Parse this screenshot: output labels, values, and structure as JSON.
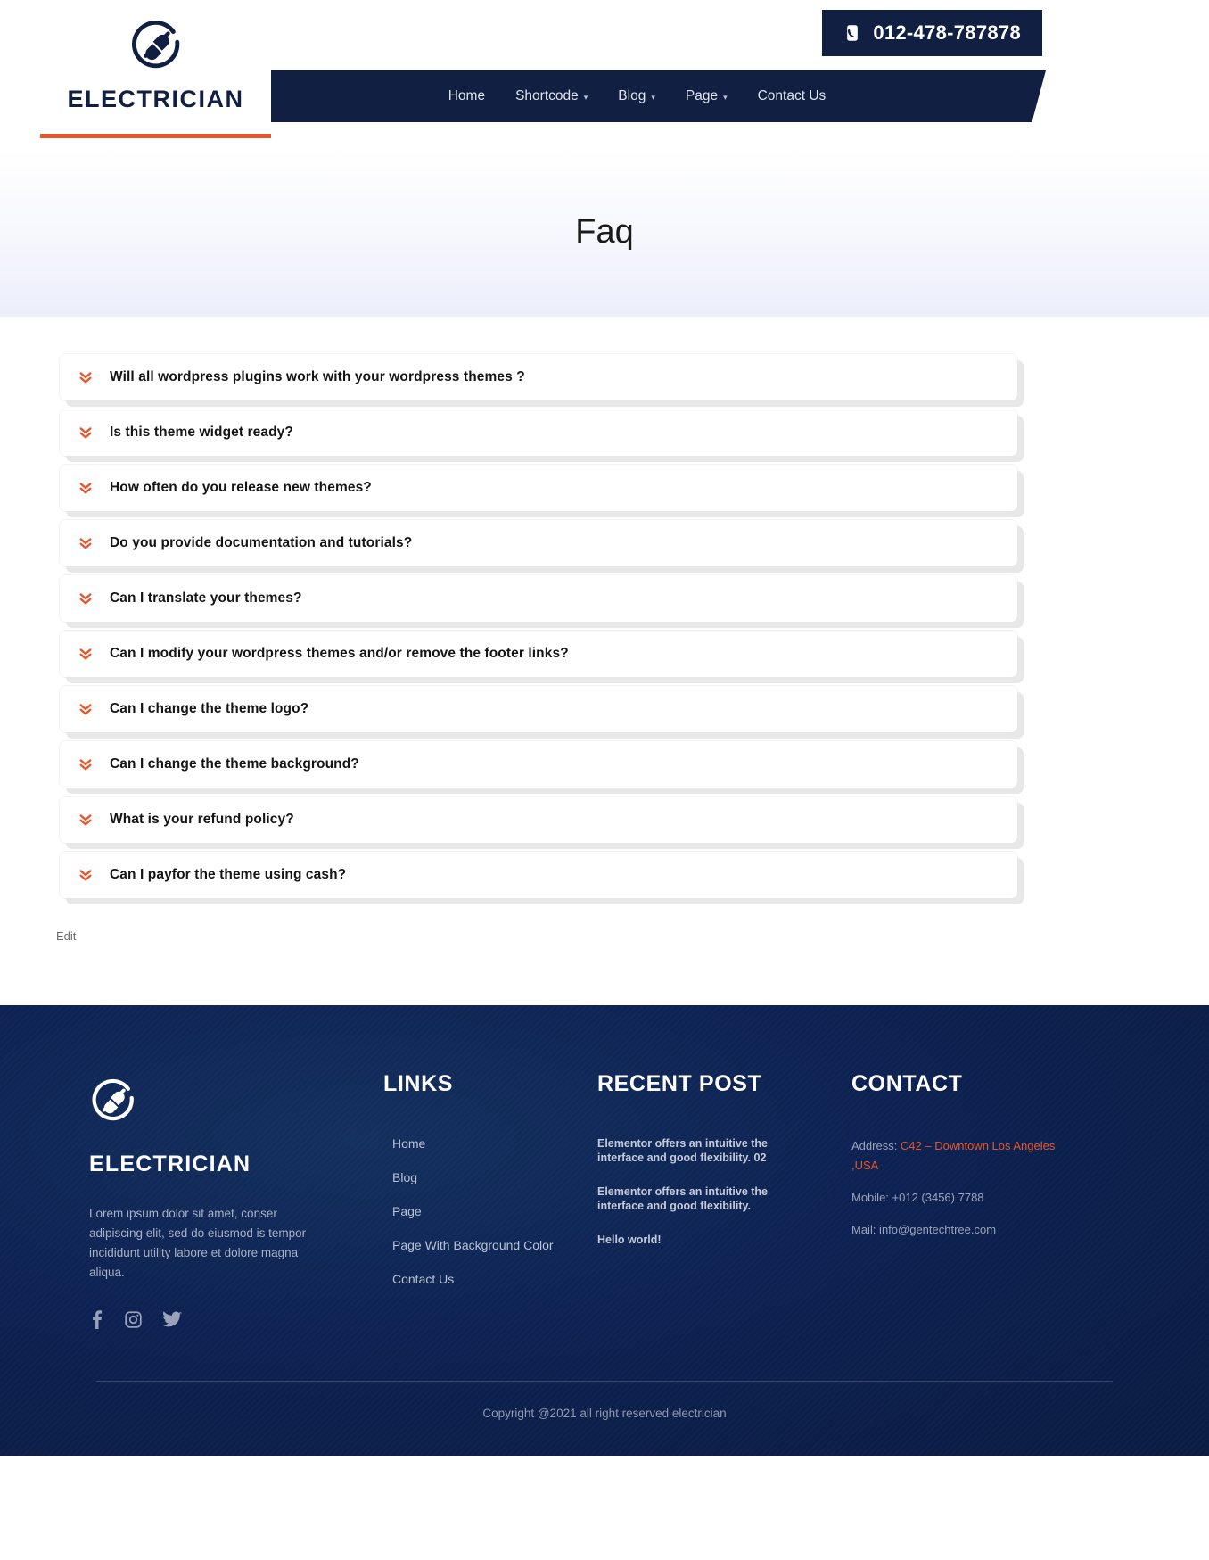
{
  "header": {
    "brand_name": "ELECTRICIAN",
    "logo_icon": "electric-plug-circle-icon",
    "phone": {
      "number": "012-478-787878",
      "icon": "phone-icon"
    },
    "nav": [
      {
        "label": "Home",
        "has_caret": false
      },
      {
        "label": "Shortcode",
        "has_caret": true
      },
      {
        "label": "Blog",
        "has_caret": true
      },
      {
        "label": "Page",
        "has_caret": true
      },
      {
        "label": "Contact Us",
        "has_caret": false
      }
    ],
    "accent_color": "#e8552a",
    "navy_color": "#101f42"
  },
  "banner": {
    "title": "Faq"
  },
  "faq": {
    "icon": "angle-double-down-icon",
    "items": [
      {
        "question": "Will all wordpress plugins work with your wordpress themes ?"
      },
      {
        "question": "Is this theme widget ready?"
      },
      {
        "question": "How often do you release new themes?"
      },
      {
        "question": "Do you provide documentation and tutorials?"
      },
      {
        "question": "Can I translate your themes?"
      },
      {
        "question": "Can I modify your wordpress themes and/or remove the footer links?"
      },
      {
        "question": "Can I change the theme logo?"
      },
      {
        "question": "Can I change the theme background?"
      },
      {
        "question": "What is your refund policy?"
      },
      {
        "question": "Can I payfor the theme using cash?"
      }
    ],
    "edit_label": "Edit"
  },
  "footer": {
    "brand_name": "ELECTRICIAN",
    "logo_icon": "electric-plug-circle-icon",
    "description": "Lorem ipsum dolor sit amet, conser adipiscing elit, sed do eiusmod is tempor incididunt utility labore et dolore magna aliqua.",
    "socials": [
      {
        "name": "facebook-icon"
      },
      {
        "name": "instagram-icon"
      },
      {
        "name": "twitter-icon"
      }
    ],
    "links": {
      "heading": "LINKS",
      "items": [
        {
          "label": "Home"
        },
        {
          "label": "Blog"
        },
        {
          "label": "Page"
        },
        {
          "label": "Page With Background Color"
        },
        {
          "label": "Contact Us"
        }
      ]
    },
    "recent_post": {
      "heading": "RECENT POST",
      "items": [
        {
          "title": "Elementor offers an intuitive the interface and good flexibility. 02"
        },
        {
          "title": "Elementor offers an intuitive the interface and good flexibility."
        },
        {
          "title": "Hello world!"
        }
      ]
    },
    "contact": {
      "heading": "CONTACT",
      "address_label": "Address: ",
      "address_value": "C42 – Downtown Los Angeles ,USA",
      "mobile": "Mobile: +012 (3456) 7788",
      "mail": "Mail: info@gentechtree.com"
    },
    "copyright": "Copyright @2021 all right reserved electrician"
  }
}
